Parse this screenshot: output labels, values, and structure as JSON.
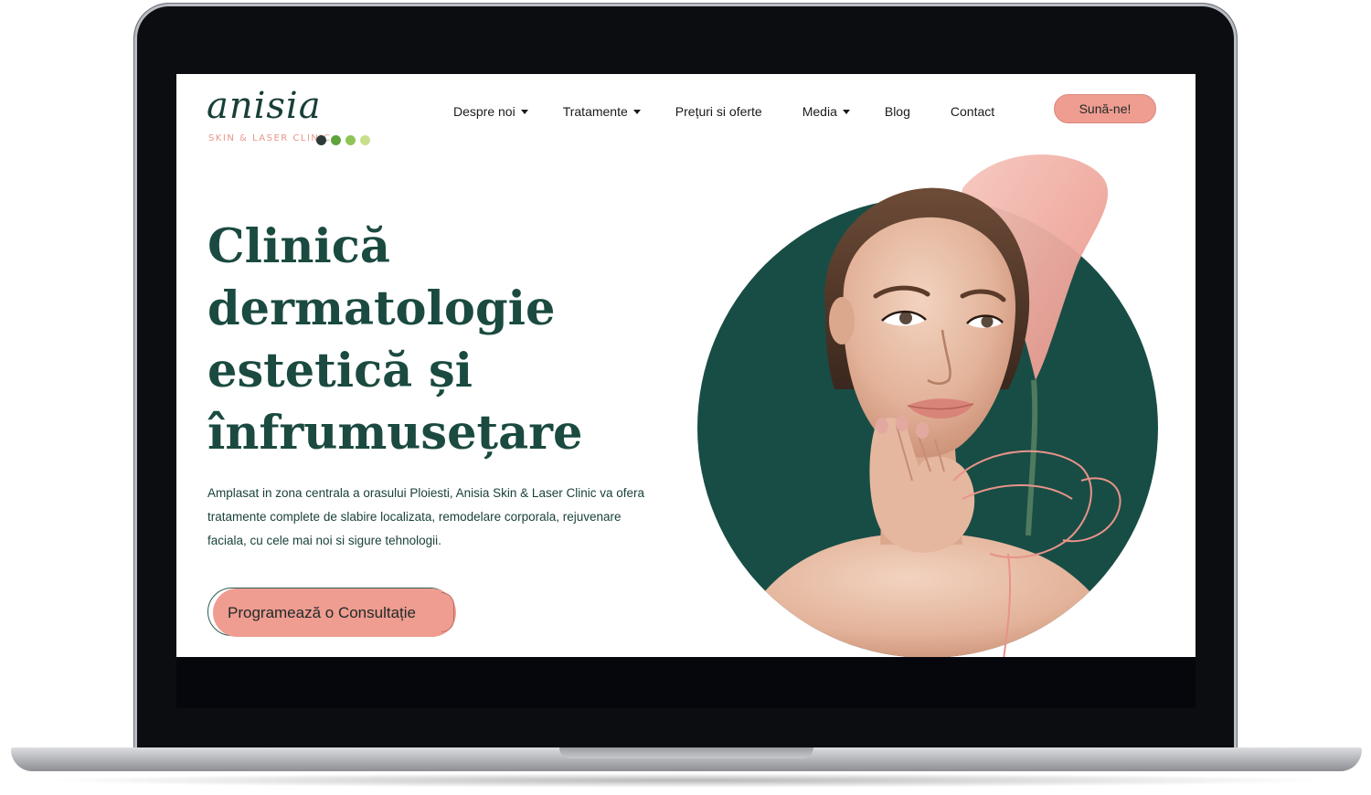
{
  "logo": {
    "wordmark": "anisia",
    "subtitle": "SKIN & LASER CLINIC",
    "dot_colors": [
      "#2b3a36",
      "#5ea33b",
      "#8ec456",
      "#c9df8e"
    ]
  },
  "nav": {
    "items": [
      {
        "label": "Despre noi",
        "dropdown": true
      },
      {
        "label": "Tratamente",
        "dropdown": true
      },
      {
        "label": "Prețuri si oferte",
        "dropdown": false
      },
      {
        "label": "Media",
        "dropdown": true
      },
      {
        "label": "Blog",
        "dropdown": false
      },
      {
        "label": "Contact",
        "dropdown": false
      }
    ],
    "call_label": "Sună-ne!"
  },
  "hero": {
    "title_lines": [
      "Clinică",
      "dermatologie",
      "estetică și",
      "înfrumusețare"
    ],
    "description": "Amplasat in zona centrala a orasului Ploiesti, Anisia Skin & Laser Clinic va ofera tratamente complete de slabire localizata, remodelare corporala, rejuvenare faciala, cu cele mai noi si sigure tehnologii.",
    "cta_label": "Programează o Consultație"
  },
  "colors": {
    "brand_green": "#1a4a40",
    "circle_green": "#184d45",
    "accent_pink": "#ef9c91"
  }
}
